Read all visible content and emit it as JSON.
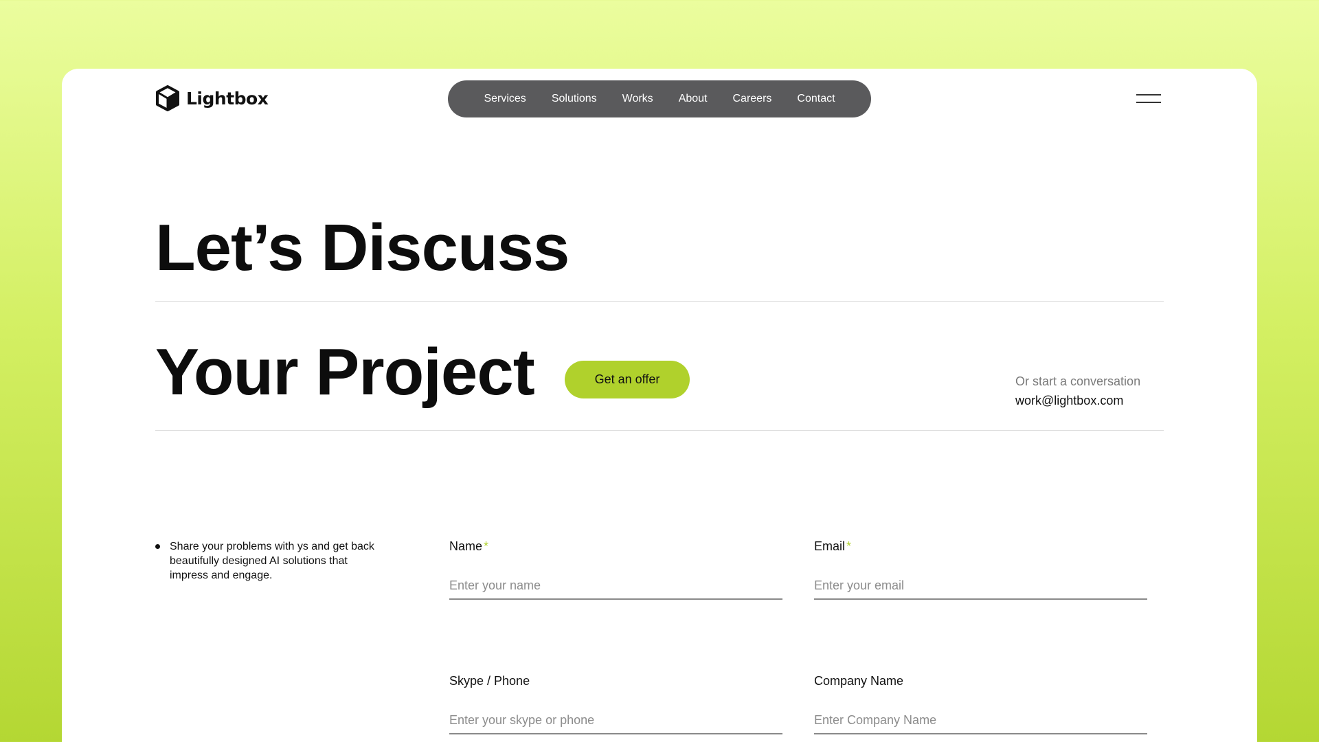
{
  "brand": {
    "name": "Lightbox",
    "icon": "cube-icon"
  },
  "nav": {
    "items": [
      {
        "label": "Services"
      },
      {
        "label": "Solutions"
      },
      {
        "label": "Works"
      },
      {
        "label": "About"
      },
      {
        "label": "Careers"
      },
      {
        "label": "Contact"
      }
    ],
    "menu_icon": "hamburger-menu-icon"
  },
  "hero": {
    "line1": "Let’s Discuss",
    "line2": "Your Project",
    "cta_label": "Get an offer"
  },
  "conversation": {
    "label": "Or start a conversation",
    "email": "work@lightbox.com"
  },
  "intro": {
    "text": "Share your problems with ys and get back beautifully designed AI solutions that impress and engage."
  },
  "form": {
    "name": {
      "label": "Name",
      "required_mark": "*",
      "placeholder": "Enter your name"
    },
    "email": {
      "label": "Email",
      "required_mark": "*",
      "placeholder": "Enter your email"
    },
    "skype": {
      "label": "Skype / Phone",
      "placeholder": "Enter your skype or phone"
    },
    "company": {
      "label": "Company Name",
      "placeholder": "Enter Company Name"
    }
  },
  "colors": {
    "accent": "#b0d12c",
    "nav_bg": "#5a5a5c",
    "background_top": "#ebfd9e",
    "background_bottom": "#b4d733"
  }
}
